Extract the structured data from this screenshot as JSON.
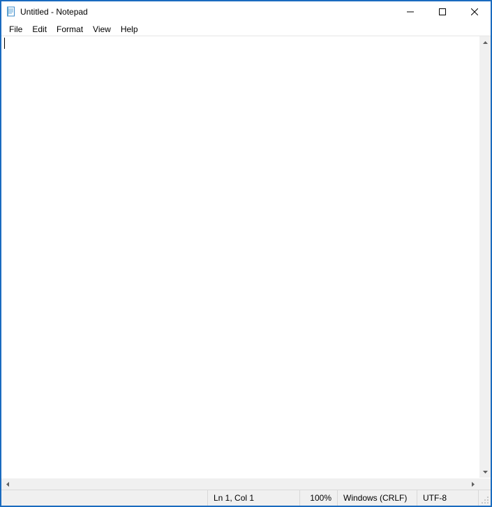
{
  "titlebar": {
    "title": "Untitled - Notepad"
  },
  "menus": {
    "file": "File",
    "edit": "Edit",
    "format": "Format",
    "view": "View",
    "help": "Help"
  },
  "editor": {
    "content": ""
  },
  "statusbar": {
    "position": "Ln 1, Col 1",
    "zoom": "100%",
    "line_ending": "Windows (CRLF)",
    "encoding": "UTF-8"
  }
}
